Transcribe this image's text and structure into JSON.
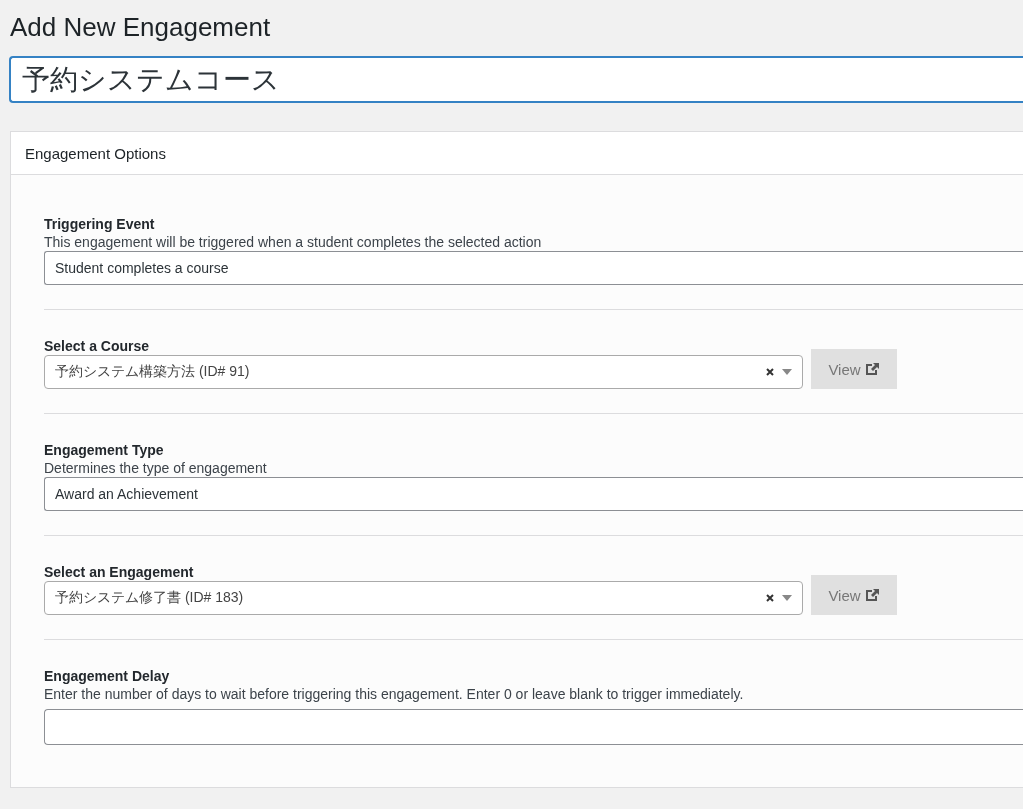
{
  "page_title": "Add New Engagement",
  "title_field": {
    "value": "予約システムコース"
  },
  "panel": {
    "heading": "Engagement Options",
    "fields": [
      {
        "kind": "select",
        "label": "Triggering Event",
        "description": "This engagement will be triggered when a student completes the selected action",
        "value": "Student completes a course"
      },
      {
        "kind": "combo",
        "label": "Select a Course",
        "value": "予約システム構築方法 (ID# 91)",
        "button": "View"
      },
      {
        "kind": "select",
        "label": "Engagement Type",
        "description": "Determines the type of engagement",
        "value": "Award an Achievement"
      },
      {
        "kind": "combo",
        "label": "Select an Engagement",
        "value": "予約システム修了書 (ID# 183)",
        "button": "View"
      },
      {
        "kind": "text",
        "label": "Engagement Delay",
        "description": "Enter the number of days to wait before triggering this engagement. Enter 0 or leave blank to trigger immediately."
      }
    ]
  }
}
